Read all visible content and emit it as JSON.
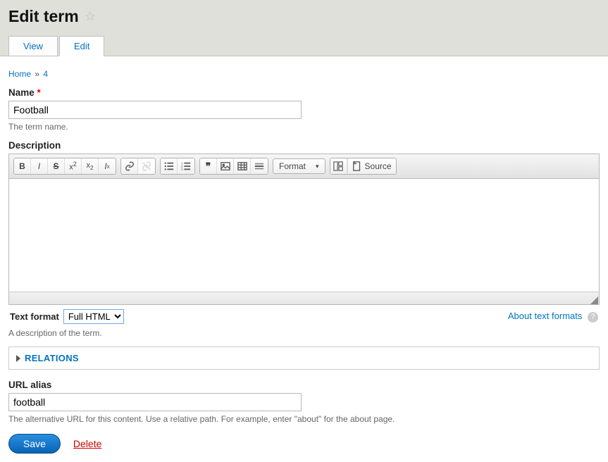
{
  "page": {
    "title": "Edit term"
  },
  "tabs": {
    "view": "View",
    "edit": "Edit"
  },
  "breadcrumb": {
    "home": "Home",
    "term_id": "4",
    "sep": "»"
  },
  "fields": {
    "name": {
      "label": "Name",
      "value": "Football",
      "help": "The term name."
    },
    "description": {
      "label": "Description",
      "help": "A description of the term.",
      "value": ""
    },
    "url_alias": {
      "label": "URL alias",
      "value": "football",
      "help": "The alternative URL for this content. Use a relative path. For example, enter \"about\" for the about page."
    }
  },
  "editor_toolbar": {
    "format_label": "Format",
    "source_label": "Source"
  },
  "text_format": {
    "label": "Text format",
    "selected": "Full HTML",
    "about_link": "About text formats"
  },
  "sections": {
    "relations": "RELATIONS"
  },
  "actions": {
    "save": "Save",
    "delete": "Delete"
  }
}
